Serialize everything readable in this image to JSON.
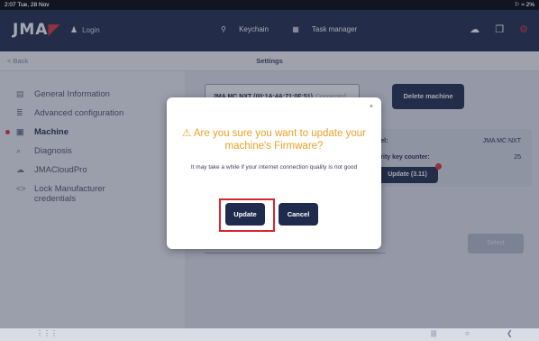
{
  "status_bar": {
    "left": "2:07  Tue, 28 Nov",
    "right": "⚐ ≈ 2%"
  },
  "app_bar": {
    "logo_text": "JMA",
    "logo_accent": "◤",
    "login_label": "Login",
    "keychain_label": "Keychain",
    "task_manager_label": "Task manager"
  },
  "sub_bar": {
    "back_label": "< Back",
    "title": "Settings"
  },
  "sidebar": {
    "items": [
      {
        "label": "General Information",
        "icon": "▤"
      },
      {
        "label": "Advanced configuration",
        "icon": "≣"
      },
      {
        "label": "Machine",
        "icon": "▣"
      },
      {
        "label": "Diagnosis",
        "icon": "⌕"
      },
      {
        "label": "JMACloudPro",
        "icon": "☁"
      },
      {
        "label": "Lock Manufacturer credentials",
        "icon": "<>"
      }
    ]
  },
  "main": {
    "machine_chip": "JMA MC NXT (00:1A:4A:71:0F:51)",
    "machine_status": "Connected",
    "delete_button": "Delete machine",
    "info": {
      "model_label": "del:",
      "model_value": "JMA MC NXT",
      "counter_label": "urity key counter:",
      "counter_value": "25",
      "firmware_button": "Update (3.11)"
    },
    "select_button": "Select"
  },
  "dialog": {
    "close": "×",
    "title": "⚠ Are you sure you want to update your machine's Firmware?",
    "message": "It may take a while if your internet connection quality is not good",
    "update_button": "Update",
    "cancel_button": "Cancel"
  },
  "colors": {
    "navy": "#1f2b4d",
    "accent_red": "#e2323a",
    "warning_orange": "#e8a127"
  }
}
